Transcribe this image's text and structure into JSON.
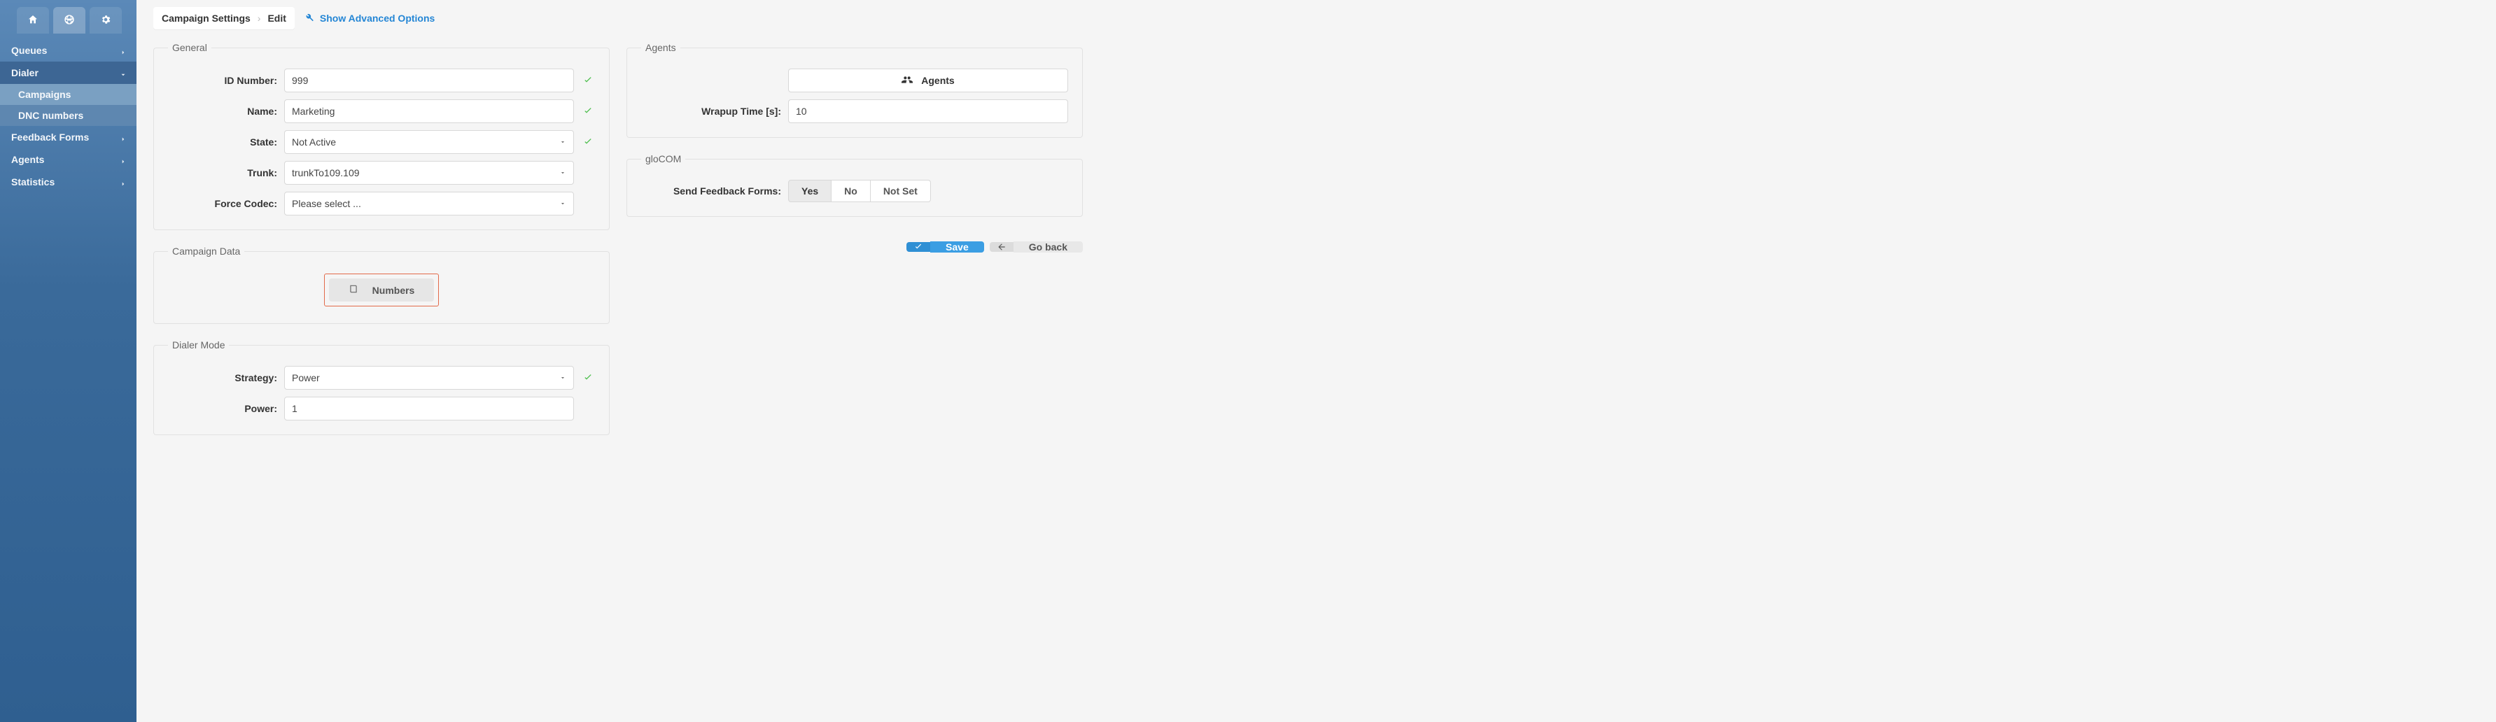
{
  "sidebar": {
    "items": [
      {
        "label": "Queues"
      },
      {
        "label": "Dialer",
        "expanded": true,
        "sub": [
          {
            "label": "Campaigns",
            "active": true
          },
          {
            "label": "DNC numbers"
          }
        ]
      },
      {
        "label": "Feedback Forms"
      },
      {
        "label": "Agents"
      },
      {
        "label": "Statistics"
      }
    ]
  },
  "breadcrumb": {
    "root": "Campaign Settings",
    "current": "Edit"
  },
  "show_advanced_label": "Show Advanced Options",
  "general": {
    "legend": "General",
    "id_label": "ID Number:",
    "id_value": "999",
    "name_label": "Name:",
    "name_value": "Marketing",
    "state_label": "State:",
    "state_value": "Not Active",
    "trunk_label": "Trunk:",
    "trunk_value": "trunkTo109.109",
    "codec_label": "Force Codec:",
    "codec_value": "Please select ..."
  },
  "campaign_data": {
    "legend": "Campaign Data",
    "numbers_label": "Numbers"
  },
  "dialer_mode": {
    "legend": "Dialer Mode",
    "strategy_label": "Strategy:",
    "strategy_value": "Power",
    "power_label": "Power:",
    "power_value": "1"
  },
  "agents": {
    "legend": "Agents",
    "button_label": "Agents",
    "wrapup_label": "Wrapup Time [s]:",
    "wrapup_value": "10"
  },
  "glocom": {
    "legend": "gloCOM",
    "feedback_label": "Send Feedback Forms:",
    "options": {
      "yes": "Yes",
      "no": "No",
      "notset": "Not Set"
    }
  },
  "actions": {
    "save": "Save",
    "go_back": "Go back"
  }
}
